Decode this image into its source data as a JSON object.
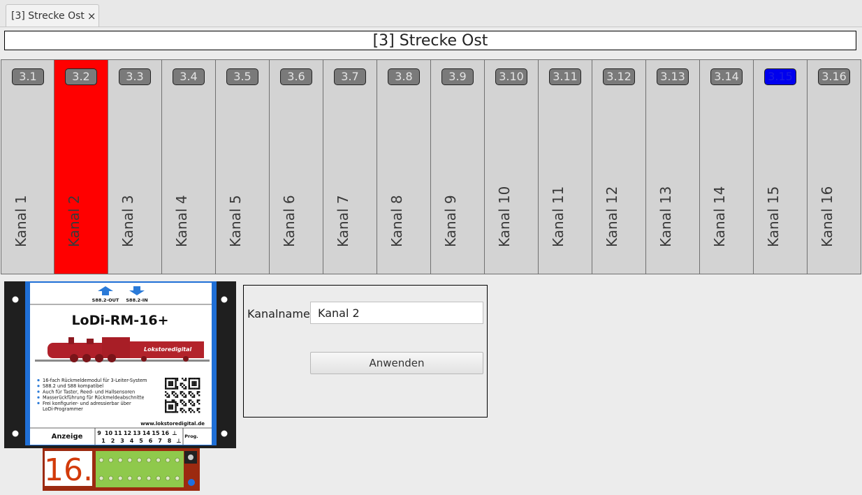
{
  "tab": {
    "label": "[3] Strecke Ost",
    "close_glyph": "×"
  },
  "title": "[3] Strecke Ost",
  "selected_channel": 2,
  "colors": {
    "selected": "#ff0000",
    "active_badge": "#0000ee"
  },
  "channels": [
    {
      "badge": "3.1",
      "label": "Kanal 1"
    },
    {
      "badge": "3.2",
      "label": "Kanal 2"
    },
    {
      "badge": "3.3",
      "label": "Kanal 3"
    },
    {
      "badge": "3.4",
      "label": "Kanal 4"
    },
    {
      "badge": "3.5",
      "label": "Kanal 5"
    },
    {
      "badge": "3.6",
      "label": "Kanal 6"
    },
    {
      "badge": "3.7",
      "label": "Kanal 7"
    },
    {
      "badge": "3.8",
      "label": "Kanal 8"
    },
    {
      "badge": "3.9",
      "label": "Kanal 9"
    },
    {
      "badge": "3.10",
      "label": "Kanal 10"
    },
    {
      "badge": "3.11",
      "label": "Kanal 11"
    },
    {
      "badge": "3.12",
      "label": "Kanal 12"
    },
    {
      "badge": "3.13",
      "label": "Kanal 13"
    },
    {
      "badge": "3.14",
      "label": "Kanal 14"
    },
    {
      "badge": "3.15",
      "label": "Kanal 15"
    },
    {
      "badge": "3.16",
      "label": "Kanal 16"
    }
  ],
  "device": {
    "out_label": "S88.2-OUT",
    "in_label": "S88.2-IN",
    "name": "LoDi-RM-16+",
    "brand": "Lokstoredigital",
    "features": [
      "16-fach Rückmeldemodul für 3-Leiter-System",
      "S88.2 und S88 kompatibel",
      "Auch für Taster, Reed- und Hallsensoren",
      "Masserückführung für Rückmeldeabschnitte",
      "Frei konfigurier- und adressierbar über",
      "LoDi-Programmer"
    ],
    "url": "www.lokstoredigital.de",
    "display_label": "Anzeige",
    "pins_top": [
      "9",
      "10",
      "11",
      "12",
      "13",
      "14",
      "15",
      "16",
      "⊥"
    ],
    "pins_bottom": [
      "1",
      "2",
      "3",
      "4",
      "5",
      "6",
      "7",
      "8",
      "⊥"
    ],
    "prog_label": "Prog.",
    "display_value": "16."
  },
  "form": {
    "name_label": "Kanalname:",
    "name_value": "Kanal 2",
    "apply_label": "Anwenden"
  }
}
